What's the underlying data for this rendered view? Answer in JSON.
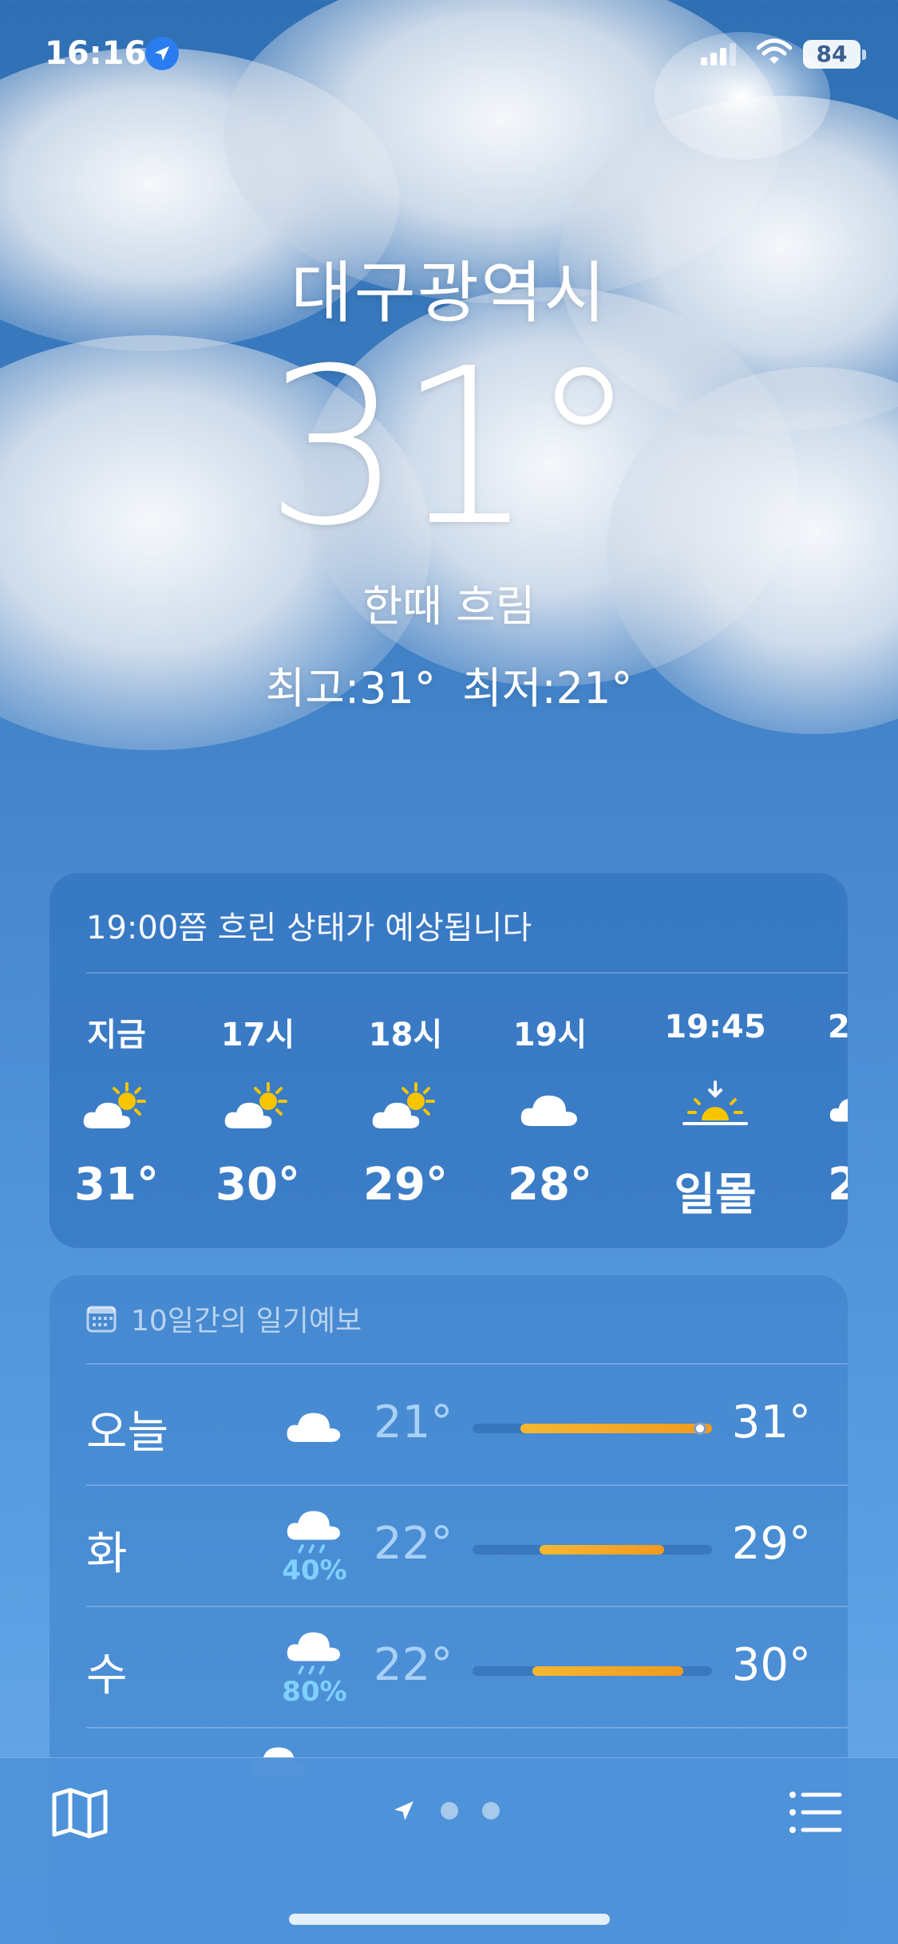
{
  "status_bar": {
    "time": "16:16",
    "battery": "84",
    "icons": [
      "location-arrow-icon",
      "cellular-signal-icon",
      "wifi-icon",
      "battery-icon"
    ]
  },
  "current": {
    "city": "대구광역시",
    "temperature": "31°",
    "condition": "한때 흐림",
    "high": "최고:31°",
    "low": "최저:21°"
  },
  "hourly": {
    "summary": "19:00쯤 흐린 상태가 예상됩니다",
    "items": [
      {
        "label": "지금",
        "icon": "partly-cloudy-sun-icon",
        "value": "31°"
      },
      {
        "label": "17시",
        "icon": "partly-cloudy-sun-icon",
        "value": "30°"
      },
      {
        "label": "18시",
        "icon": "partly-cloudy-sun-icon",
        "value": "29°"
      },
      {
        "label": "19시",
        "icon": "cloud-icon",
        "value": "28°"
      },
      {
        "label": "19:45",
        "icon": "sunset-icon",
        "value": "일몰"
      },
      {
        "label": "2",
        "icon": "cloud-icon",
        "value": "2"
      }
    ]
  },
  "forecast": {
    "header": "10일간의 일기예보",
    "rows": [
      {
        "day": "오늘",
        "icon": "cloud-icon",
        "pop": "",
        "low": "21°",
        "high": "31°",
        "range_start": 0.2,
        "range_end": 1.0,
        "current": 0.95
      },
      {
        "day": "화",
        "icon": "cloud-rain-icon",
        "pop": "40%",
        "low": "22°",
        "high": "29°",
        "range_start": 0.28,
        "range_end": 0.8,
        "current": null
      },
      {
        "day": "수",
        "icon": "cloud-rain-icon",
        "pop": "80%",
        "low": "22°",
        "high": "30°",
        "range_start": 0.25,
        "range_end": 0.88,
        "current": null
      }
    ]
  },
  "colors": {
    "bar_fill": "#f5b830",
    "pop_text": "#7fd0ff",
    "sun": "#f7c500"
  },
  "tab_bar": {
    "icons": [
      "map-icon",
      "location-arrow-icon",
      "page-dot",
      "page-dot",
      "list-icon"
    ]
  }
}
